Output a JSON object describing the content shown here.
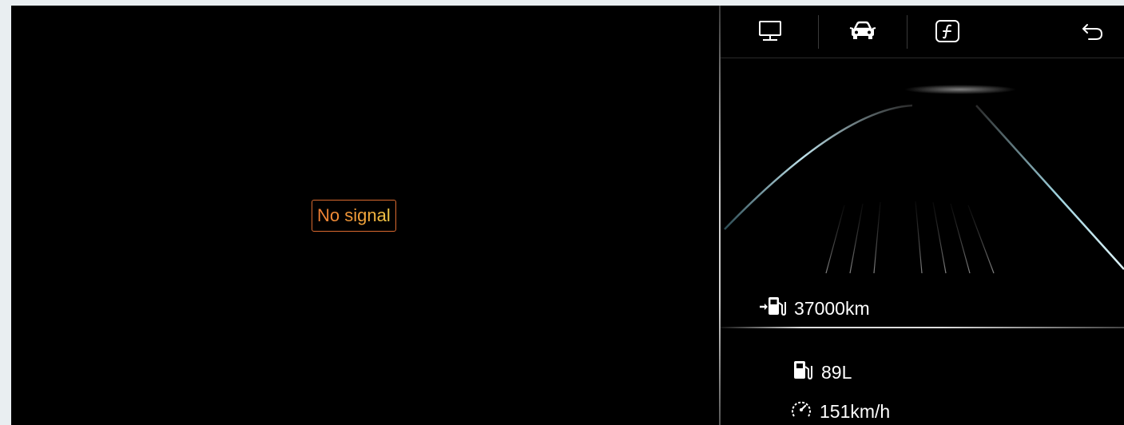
{
  "camera": {
    "status_text": "No signal"
  },
  "panel": {
    "tabs": [
      {
        "name": "monitor-icon",
        "active": false
      },
      {
        "name": "car-icon",
        "active": true
      },
      {
        "name": "function-icon",
        "active": false
      }
    ],
    "back_icon": "back-arrow-icon",
    "range": {
      "icon": "fuel-range-icon",
      "value": "37000km"
    },
    "fuel": {
      "icon": "fuel-pump-icon",
      "value": "89L"
    },
    "speed": {
      "icon": "speedometer-icon",
      "value": "151km/h"
    }
  },
  "colors": {
    "background": "#000000",
    "warning_border": "#d9692f",
    "text": "#ffffff",
    "road_line": "#8fc7d6"
  }
}
